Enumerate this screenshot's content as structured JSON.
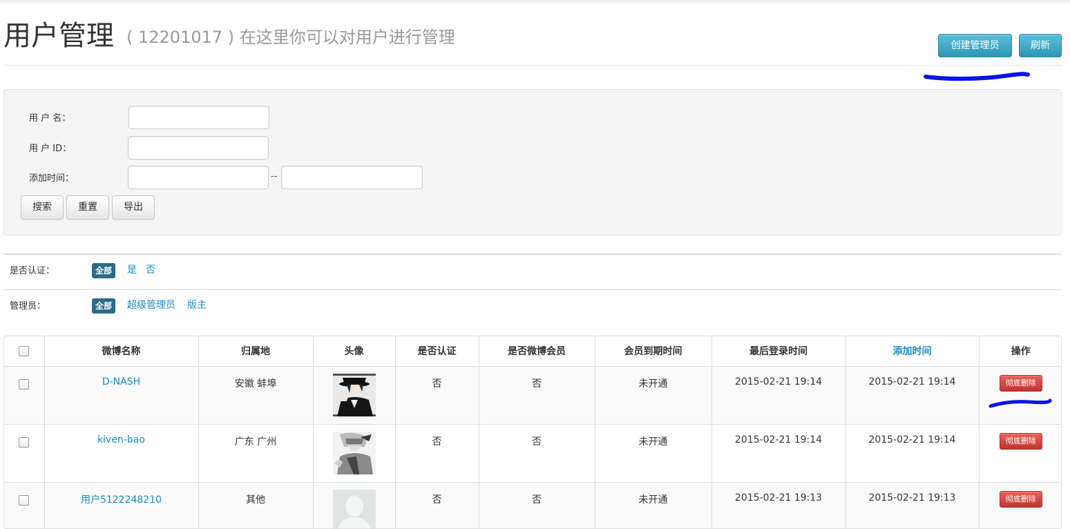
{
  "header": {
    "title": "用户管理",
    "subtitle": "( 12201017 ) 在这里你可以对用户进行管理",
    "create_admin_label": "创建管理员",
    "refresh_label": "刷新"
  },
  "annotation_color": "#0a14e6",
  "search": {
    "username_label": "用 户 名：",
    "userid_label": "用 户 ID：",
    "addtime_label": "添加时间：",
    "range_separator": "--",
    "username_value": "",
    "userid_value": "",
    "addtime_from_value": "",
    "addtime_to_value": "",
    "search_label": "搜索",
    "reset_label": "重置",
    "export_label": "导出"
  },
  "filters": {
    "verified": {
      "label": "是否认证：",
      "active": "全部",
      "options": [
        "是",
        "否"
      ]
    },
    "admin": {
      "label": "管理员：",
      "active": "全部",
      "options": [
        "超级管理员",
        "版主"
      ]
    }
  },
  "table": {
    "columns": [
      "微博名称",
      "归属地",
      "头像",
      "是否认证",
      "是否微博会员",
      "会员到期时间",
      "最后登录时间",
      "添加时间",
      "操作"
    ],
    "rows": [
      {
        "name": "D-NASH",
        "location": "安徽 蚌埠",
        "avatar": "avatar-anime-hat",
        "verified": "否",
        "weibo_member": "否",
        "member_expire": "未开通",
        "last_login": "2015-02-21 19:14",
        "added": "2015-02-21 19:14",
        "action": "彻底删除"
      },
      {
        "name": "kiven-bao",
        "location": "广东 广州",
        "avatar": "avatar-sketch-boy",
        "verified": "否",
        "weibo_member": "否",
        "member_expire": "未开通",
        "last_login": "2015-02-21 19:14",
        "added": "2015-02-21 19:14",
        "action": "彻底删除"
      },
      {
        "name": "用户5122248210",
        "location": "其他",
        "avatar": "avatar-default-silhouette",
        "verified": "否",
        "weibo_member": "否",
        "member_expire": "未开通",
        "last_login": "2015-02-21 19:13",
        "added": "2015-02-21 19:13",
        "action": "彻底删除"
      }
    ]
  }
}
